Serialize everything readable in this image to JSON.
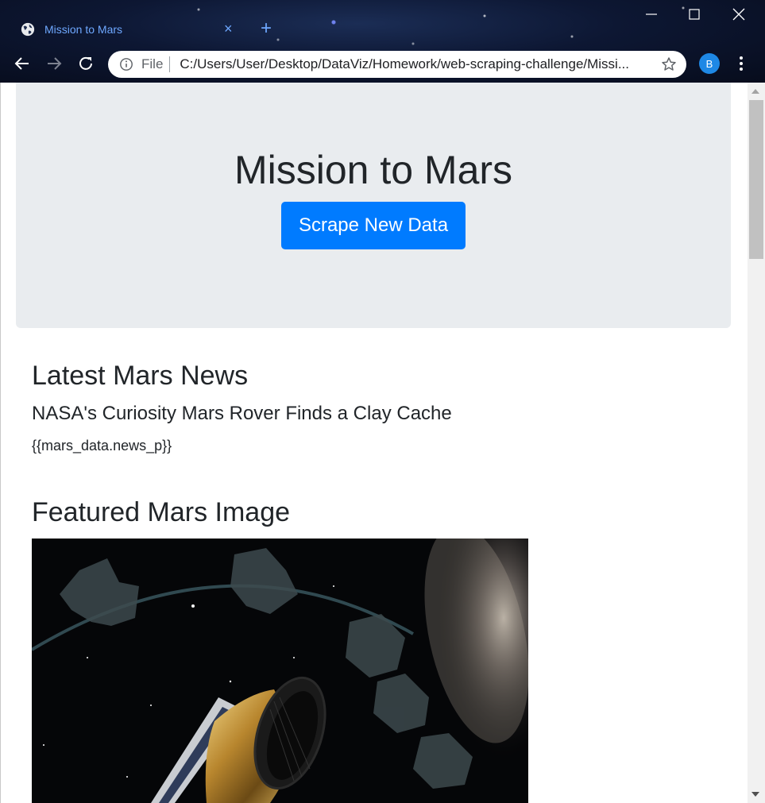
{
  "browser": {
    "tab": {
      "title": "Mission to Mars",
      "close_label": "×"
    },
    "new_tab_label": "+",
    "omnibox": {
      "scheme_label": "File",
      "url": "C:/Users/User/Desktop/DataViz/Homework/web-scraping-challenge/Missi..."
    },
    "profile_initial": "B",
    "colors": {
      "tab_accent": "#6ea8ff",
      "profile": "#1e88e5"
    }
  },
  "page": {
    "jumbotron": {
      "title": "Mission to Mars",
      "button_label": "Scrape New Data",
      "button_color": "#007bff",
      "background": "#e9ecef"
    },
    "news": {
      "heading": "Latest Mars News",
      "title": "NASA's Curiosity Mars Rover Finds a Clay Cache",
      "paragraph": "{{mars_data.news_p}}"
    },
    "featured": {
      "heading": "Featured Mars Image"
    }
  }
}
